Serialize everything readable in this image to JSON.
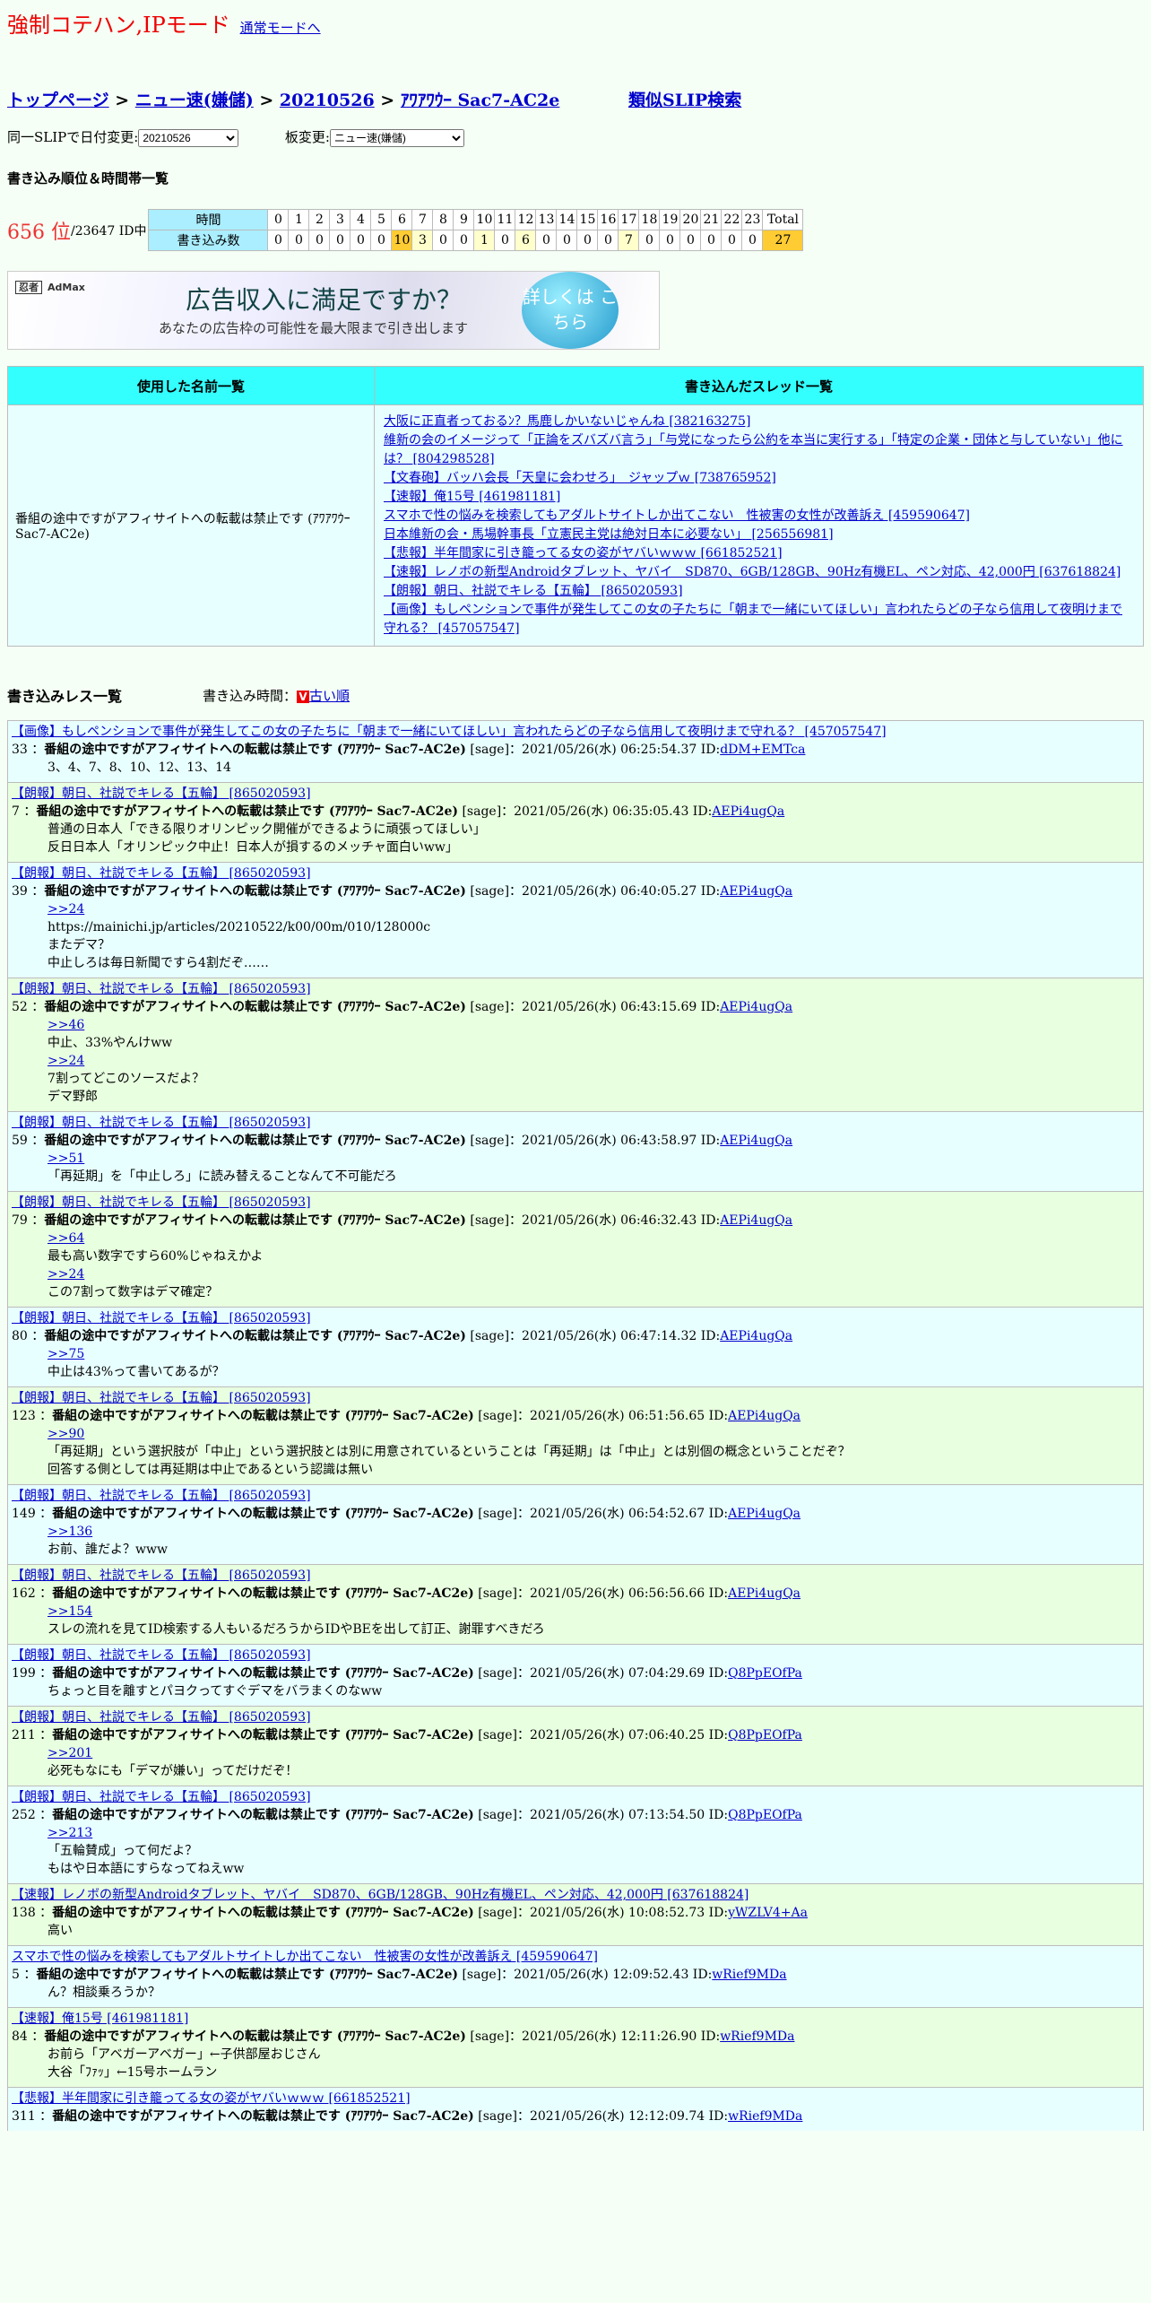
{
  "header": {
    "mode_title": "強制コテハン,IPモード",
    "normal_mode_link": "通常モードへ"
  },
  "breadcrumb": {
    "top": "トップページ",
    "board": "ニュー速(嫌儲)",
    "date": "20210526",
    "slip": "ｱﾜｱﾜｳｰ Sac7-AC2e",
    "similar": "類似SLIP検索",
    "sep": " > "
  },
  "selectors": {
    "date_label": "同一SLIPで日付変更:",
    "date_value": "20210526",
    "board_label": "板変更:",
    "board_value": "ニュー速(嫌儲)"
  },
  "ranking": {
    "section_title": "書き込み順位＆時間帯一覧",
    "rank": "656 位",
    "total_ids": "/23647 ID中",
    "row_time_label": "時間",
    "row_count_label": "書き込み数",
    "hours": [
      "0",
      "1",
      "2",
      "3",
      "4",
      "5",
      "6",
      "7",
      "8",
      "9",
      "10",
      "11",
      "12",
      "13",
      "14",
      "15",
      "16",
      "17",
      "18",
      "19",
      "20",
      "21",
      "22",
      "23"
    ],
    "counts": [
      "0",
      "0",
      "0",
      "0",
      "0",
      "0",
      "10",
      "3",
      "0",
      "0",
      "1",
      "0",
      "6",
      "0",
      "0",
      "0",
      "0",
      "7",
      "0",
      "0",
      "0",
      "0",
      "0",
      "0"
    ],
    "total_label": "Total",
    "total_value": "27"
  },
  "ad": {
    "brand": "AdMax",
    "brand_tag": "忍者",
    "headline": "広告収入に満足ですか？",
    "sub": "あなたの広告枠の可能性を最大限まで引き出します",
    "button": "詳しくは こちら"
  },
  "names_table": {
    "col_names": "使用した名前一覧",
    "col_threads": "書き込んだスレッド一覧",
    "name": "番組の途中ですがアフィサイトへの転載は禁止です (ｱﾜｱﾜｳｰ Sac7-AC2e)",
    "threads": [
      "大阪に正直者っておるﾝ？馬鹿しかいないじゃんね [382163275]",
      "維新の会のイメージって「正論をズバズバ言う」「与党になったら公約を本当に実行する」「特定の企業・団体と与していない」他には？ [804298528]",
      "【文春砲】バッハ会長「天皇に会わせろ」　ジャップｗ [738765952]",
      "【速報】俺15号 [461981181]",
      "スマホで性の悩みを検索してもアダルトサイトしか出てこない　性被害の女性が改善訴え [459590647]",
      "日本維新の会・馬場幹事長「立憲民主党は絶対日本に必要ない」 [256556981]",
      "【悲報】半年間家に引き籠ってる女の姿がヤバいｗｗｗ [661852521]",
      "【速報】レノボの新型Androidタブレット、ヤバイ　SD870、6GB/128GB、90Hz有機EL、ペン対応、42,000円 [637618824]",
      "【朗報】朝日、社説でキレる【五輪】 [865020593]",
      "【画像】もしペンションで事件が発生してこの女の子たちに「朝まで一緒にいてほしい」言われたらどの子なら信用して夜明けまで守れる？ [457057547]"
    ]
  },
  "posts_section": {
    "title": "書き込みレス一覧",
    "sort_label": "書き込み時間：",
    "sort_icon": "V",
    "sort_link": "古い順"
  },
  "posts": [
    {
      "thread": "【画像】もしペンションで事件が発生してこの女の子たちに「朝まで一緒にいてほしい」言われたらどの子なら信用して夜明けまで守れる？ [457057547]",
      "num": "33",
      "name": "番組の途中ですがアフィサイトへの転載は禁止です (ｱﾜｱﾜｳｰ Sac7-AC2e)",
      "info": "[sage]：2021/05/26(水) 06:25:54.37 ID:",
      "id": "dDM+EMTca",
      "lines": [
        "3、4、7、8、10、12、13、14"
      ],
      "links": []
    },
    {
      "thread": "【朗報】朝日、社説でキレる【五輪】 [865020593]",
      "num": "7",
      "name": "番組の途中ですがアフィサイトへの転載は禁止です (ｱﾜｱﾜｳｰ Sac7-AC2e)",
      "info": "[sage]：2021/05/26(水) 06:35:05.43 ID:",
      "id": "AEPi4ugQa",
      "lines": [
        "普通の日本人「できる限りオリンピック開催ができるように頑張ってほしい」",
        "反日日本人「オリンピック中止！日本人が損するのメッチャ面白いww」"
      ],
      "links": []
    },
    {
      "thread": "【朗報】朝日、社説でキレる【五輪】 [865020593]",
      "num": "39",
      "name": "番組の途中ですがアフィサイトへの転載は禁止です (ｱﾜｱﾜｳｰ Sac7-AC2e)",
      "info": "[sage]：2021/05/26(水) 06:40:05.27 ID:",
      "id": "AEPi4ugQa",
      "pre": [
        ">>24"
      ],
      "lines": [
        "https://mainichi.jp/articles/20210522/k00/00m/010/128000c",
        "またデマ？",
        "中止しろは毎日新聞ですら4割だぞ……"
      ]
    },
    {
      "thread": "【朗報】朝日、社説でキレる【五輪】 [865020593]",
      "num": "52",
      "name": "番組の途中ですがアフィサイトへの転載は禁止です (ｱﾜｱﾜｳｰ Sac7-AC2e)",
      "info": "[sage]：2021/05/26(水) 06:43:15.69 ID:",
      "id": "AEPi4ugQa",
      "pre": [
        ">>46"
      ],
      "lines": [
        "中止、33%やんけww"
      ],
      "pre2": [
        ">>24"
      ],
      "lines2": [
        "7割ってどこのソースだよ？",
        "デマ野郎"
      ]
    },
    {
      "thread": "【朗報】朝日、社説でキレる【五輪】 [865020593]",
      "num": "59",
      "name": "番組の途中ですがアフィサイトへの転載は禁止です (ｱﾜｱﾜｳｰ Sac7-AC2e)",
      "info": "[sage]：2021/05/26(水) 06:43:58.97 ID:",
      "id": "AEPi4ugQa",
      "pre": [
        ">>51"
      ],
      "lines": [
        "「再延期」を「中止しろ」に読み替えることなんて不可能だろ"
      ]
    },
    {
      "thread": "【朗報】朝日、社説でキレる【五輪】 [865020593]",
      "num": "79",
      "name": "番組の途中ですがアフィサイトへの転載は禁止です (ｱﾜｱﾜｳｰ Sac7-AC2e)",
      "info": "[sage]：2021/05/26(水) 06:46:32.43 ID:",
      "id": "AEPi4ugQa",
      "pre": [
        ">>64"
      ],
      "lines": [
        "最も高い数字ですら60%じゃねえかよ"
      ],
      "pre2": [
        ">>24"
      ],
      "lines2": [
        "この7割って数字はデマ確定？"
      ]
    },
    {
      "thread": "【朗報】朝日、社説でキレる【五輪】 [865020593]",
      "num": "80",
      "name": "番組の途中ですがアフィサイトへの転載は禁止です (ｱﾜｱﾜｳｰ Sac7-AC2e)",
      "info": "[sage]：2021/05/26(水) 06:47:14.32 ID:",
      "id": "AEPi4ugQa",
      "pre": [
        ">>75"
      ],
      "lines": [
        "中止は43%って書いてあるが？"
      ]
    },
    {
      "thread": "【朗報】朝日、社説でキレる【五輪】 [865020593]",
      "num": "123",
      "name": "番組の途中ですがアフィサイトへの転載は禁止です (ｱﾜｱﾜｳｰ Sac7-AC2e)",
      "info": "[sage]：2021/05/26(水) 06:51:56.65 ID:",
      "id": "AEPi4ugQa",
      "pre": [
        ">>90"
      ],
      "lines": [
        "「再延期」という選択肢が「中止」という選択肢とは別に用意されているということは「再延期」は「中止」とは別個の概念ということだぞ？",
        "回答する側としては再延期は中止であるという認識は無い"
      ]
    },
    {
      "thread": "【朗報】朝日、社説でキレる【五輪】 [865020593]",
      "num": "149",
      "name": "番組の途中ですがアフィサイトへの転載は禁止です (ｱﾜｱﾜｳｰ Sac7-AC2e)",
      "info": "[sage]：2021/05/26(水) 06:54:52.67 ID:",
      "id": "AEPi4ugQa",
      "pre": [
        ">>136"
      ],
      "lines": [
        "お前、誰だよ？www"
      ]
    },
    {
      "thread": "【朗報】朝日、社説でキレる【五輪】 [865020593]",
      "num": "162",
      "name": "番組の途中ですがアフィサイトへの転載は禁止です (ｱﾜｱﾜｳｰ Sac7-AC2e)",
      "info": "[sage]：2021/05/26(水) 06:56:56.66 ID:",
      "id": "AEPi4ugQa",
      "pre": [
        ">>154"
      ],
      "lines": [
        "スレの流れを見てID検索する人もいるだろうからIDやBEを出して訂正、謝罪すべきだろ"
      ]
    },
    {
      "thread": "【朗報】朝日、社説でキレる【五輪】 [865020593]",
      "num": "199",
      "name": "番組の途中ですがアフィサイトへの転載は禁止です (ｱﾜｱﾜｳｰ Sac7-AC2e)",
      "info": "[sage]：2021/05/26(水) 07:04:29.69 ID:",
      "id": "Q8PpEOfPa",
      "lines": [
        "ちょっと目を離すとパヨクってすぐデマをバラまくのなww"
      ]
    },
    {
      "thread": "【朗報】朝日、社説でキレる【五輪】 [865020593]",
      "num": "211",
      "name": "番組の途中ですがアフィサイトへの転載は禁止です (ｱﾜｱﾜｳｰ Sac7-AC2e)",
      "info": "[sage]：2021/05/26(水) 07:06:40.25 ID:",
      "id": "Q8PpEOfPa",
      "pre": [
        ">>201"
      ],
      "lines": [
        "必死もなにも「デマが嫌い」ってだけだぞ！"
      ]
    },
    {
      "thread": "【朗報】朝日、社説でキレる【五輪】 [865020593]",
      "num": "252",
      "name": "番組の途中ですがアフィサイトへの転載は禁止です (ｱﾜｱﾜｳｰ Sac7-AC2e)",
      "info": "[sage]：2021/05/26(水) 07:13:54.50 ID:",
      "id": "Q8PpEOfPa",
      "pre": [
        ">>213"
      ],
      "lines": [
        "「五輪賛成」って何だよ？",
        "もはや日本語にすらなってねえww"
      ]
    },
    {
      "thread": "【速報】レノボの新型Androidタブレット、ヤバイ　SD870、6GB/128GB、90Hz有機EL、ペン対応、42,000円 [637618824]",
      "num": "138",
      "name": "番組の途中ですがアフィサイトへの転載は禁止です (ｱﾜｱﾜｳｰ Sac7-AC2e)",
      "info": "[sage]：2021/05/26(水) 10:08:52.73 ID:",
      "id": "yWZLV4+Aa",
      "lines": [
        "高い"
      ]
    },
    {
      "thread": "スマホで性の悩みを検索してもアダルトサイトしか出てこない　性被害の女性が改善訴え [459590647]",
      "num": "5",
      "name": "番組の途中ですがアフィサイトへの転載は禁止です (ｱﾜｱﾜｳｰ Sac7-AC2e)",
      "info": "[sage]：2021/05/26(水) 12:09:52.43 ID:",
      "id": "wRief9MDa",
      "lines": [
        "ん？相談乗ろうか？"
      ]
    },
    {
      "thread": "【速報】俺15号 [461981181]",
      "num": "84",
      "name": "番組の途中ですがアフィサイトへの転載は禁止です (ｱﾜｱﾜｳｰ Sac7-AC2e)",
      "info": "[sage]：2021/05/26(水) 12:11:26.90 ID:",
      "id": "wRief9MDa",
      "lines": [
        "お前ら「アベガーアベガー」←子供部屋おじさん",
        "大谷「ﾌｧｯ」←15号ホームラン"
      ]
    },
    {
      "thread": "【悲報】半年間家に引き籠ってる女の姿がヤバいｗｗｗ [661852521]",
      "num": "311",
      "name": "番組の途中ですがアフィサイトへの転載は禁止です (ｱﾜｱﾜｳｰ Sac7-AC2e)",
      "info": "[sage]：2021/05/26(水) 12:12:09.74 ID:",
      "id": "wRief9MDa",
      "lines": []
    }
  ]
}
